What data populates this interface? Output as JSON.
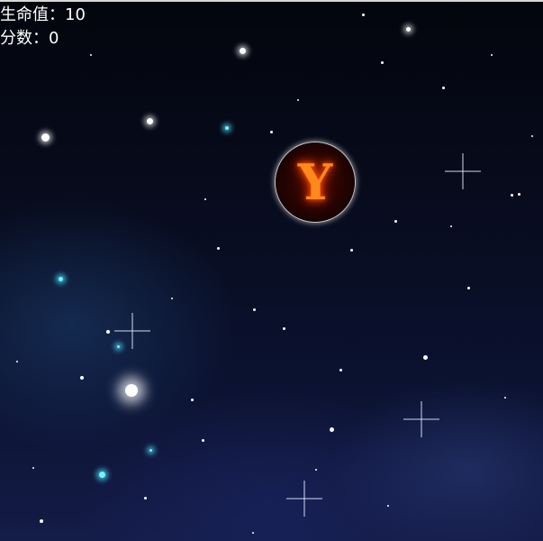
{
  "hud": {
    "life_label": "生命值：",
    "life_value": "10",
    "score_label": "分数：",
    "score_value": "0"
  },
  "enemy": {
    "letter": "Y"
  },
  "colors": {
    "hud_text": "#ffffff",
    "enemy_fire": "#ff8a1c"
  }
}
